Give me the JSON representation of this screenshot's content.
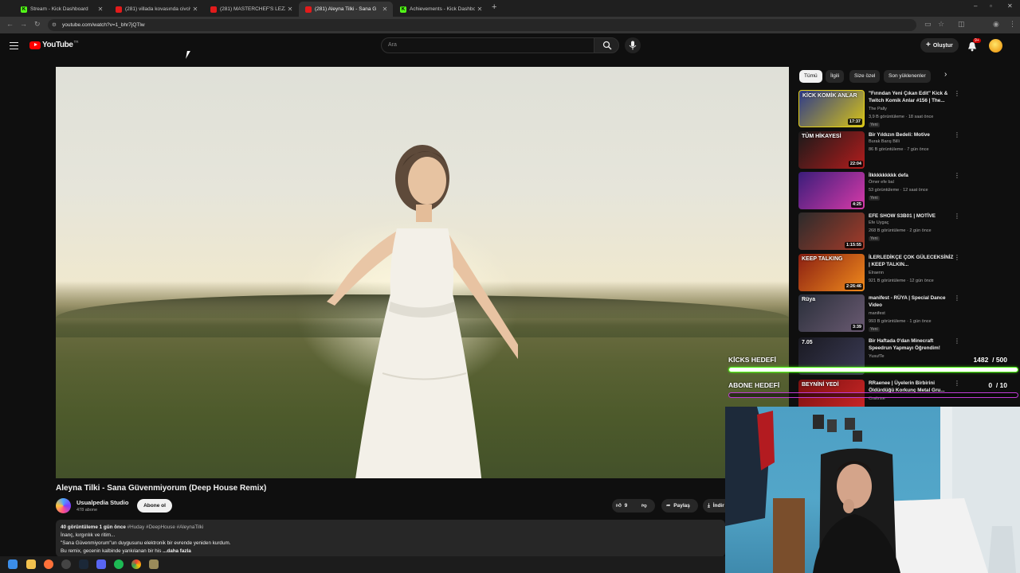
{
  "browser": {
    "tabs": [
      {
        "label": "Stream - Kick Dashboard",
        "type": "kick",
        "active": false
      },
      {
        "label": "(281) villada kovasında civciv bu",
        "type": "yt",
        "active": false
      },
      {
        "label": "(281) MASTERCHEF'S LEZZO -",
        "type": "yt",
        "active": false
      },
      {
        "label": "(281) Aleyna Tilki - Sana G",
        "type": "yt",
        "active": true
      },
      {
        "label": "Achievements - Kick Dashboard",
        "type": "kick",
        "active": false
      }
    ],
    "url": "youtube.com/watch?v=1_bhr7jQTlw"
  },
  "youtube": {
    "logo_text": "YouTube",
    "logo_region": "TR",
    "search_placeholder": "Ara",
    "create_label": "Oluştur",
    "notif_badge": "9+"
  },
  "video": {
    "title": "Aleyna Tilki - Sana Güvenmiyorum (Deep House Remix)",
    "channel": "Usualpedia Studio",
    "subscribers": "478 abone",
    "subscribe_label": "Abone ol",
    "likes": "9",
    "share_label": "Paylaş",
    "download_label": "İndir",
    "desc_meta": "40 görüntüleme  1 gün önce",
    "desc_tags": "#Huday #DeepHouse #AleynaTilki",
    "desc_line1": "İnanç, kırgınlık ve ritim...",
    "desc_line2": "\"Sana Güvenmiyorum\"un duygusunu elektronik bir evrende yeniden kurdum.",
    "desc_line3": "Bu remix, gecenin kalbinde yankılanan bir his",
    "desc_more": "...daha fazla"
  },
  "chips": [
    "Tümü",
    "İlgili",
    "Size özel",
    "Son yüklenenler"
  ],
  "recommendations": [
    {
      "title": "\"Fırından Yeni Çıkan Edit\" Kick & Twitch Komik Anlar #156 | The...",
      "channel": "The Pally",
      "stats": "3,9 B görüntüleme · 18 saat önce",
      "new": "Yeni",
      "duration": "17:37",
      "thumb_colors": [
        "#2e3b8a",
        "#d6c218"
      ],
      "thumb_text": "KİCK KOMİK ANLAR"
    },
    {
      "title": "Bir Yıldızın Bedeli: Motive",
      "channel": "Burak Barış Billi",
      "stats": "86 B görüntüleme · 7 gün önce",
      "new": "",
      "duration": "22:04",
      "thumb_colors": [
        "#1a1a1a",
        "#b21c1c"
      ],
      "thumb_text": "TÜM HİKAYESİ"
    },
    {
      "title": "İlkkkkkkkkk defa",
      "channel": "Ömer efe bal",
      "stats": "53 görüntüleme · 12 saat önce",
      "new": "Yeni",
      "duration": "4:25",
      "thumb_colors": [
        "#3a1d7a",
        "#d73aa8"
      ],
      "thumb_text": ""
    },
    {
      "title": "EFE SHOW S3B01 | MOTİVE",
      "channel": "Efe Uygaç",
      "stats": "268 B görüntüleme · 2 gün önce",
      "new": "Yeni",
      "duration": "1:15:55",
      "thumb_colors": [
        "#2b2b2b",
        "#a53b2a"
      ],
      "thumb_text": ""
    },
    {
      "title": "İLERLEDİKÇE ÇOK GÜLECEKSİNİZ | KEEP TALKIN...",
      "channel": "Elraenn",
      "stats": "921 B görüntüleme · 12 gün önce",
      "new": "",
      "duration": "2:26:46",
      "thumb_colors": [
        "#8a1f12",
        "#f08a1c"
      ],
      "thumb_text": "KEEP TALKING"
    },
    {
      "title": "manifest - RÜYA | Special Dance Video",
      "channel": "manifest",
      "stats": "993 B görüntüleme · 1 gün önce",
      "new": "Yeni",
      "duration": "3:39",
      "thumb_colors": [
        "#2a2f3a",
        "#6a5a72"
      ],
      "thumb_text": "Rüya"
    },
    {
      "title": "Bir Haftada 0'dan Minecraft Speedrun Yapmayı Öğrendim!",
      "channel": "YusufTe",
      "stats": "",
      "new": "",
      "duration": "",
      "thumb_colors": [
        "#1a1a22",
        "#3b3b55"
      ],
      "thumb_text": "7.05"
    },
    {
      "title": "RRaenee | Üyelerin Birbirini Öldürdüğü Korkunç Metal Gru...",
      "channel": "Craftrise",
      "stats": "",
      "new": "",
      "duration": "",
      "thumb_colors": [
        "#7a1010",
        "#d02828"
      ],
      "thumb_text": "BEYNİNİ YEDİ"
    }
  ],
  "overlay": {
    "kicks_label": "KİCKS HEDEFİ",
    "kicks_value": "1482",
    "kicks_target": "/ 500",
    "kicks_progress": 1.0,
    "kicks_color": "#53fc18",
    "subs_label": "ABONE HEDEFİ",
    "subs_value": "0",
    "subs_target": "/ 10",
    "subs_progress": 0.0,
    "subs_color": "#c23bd6"
  }
}
